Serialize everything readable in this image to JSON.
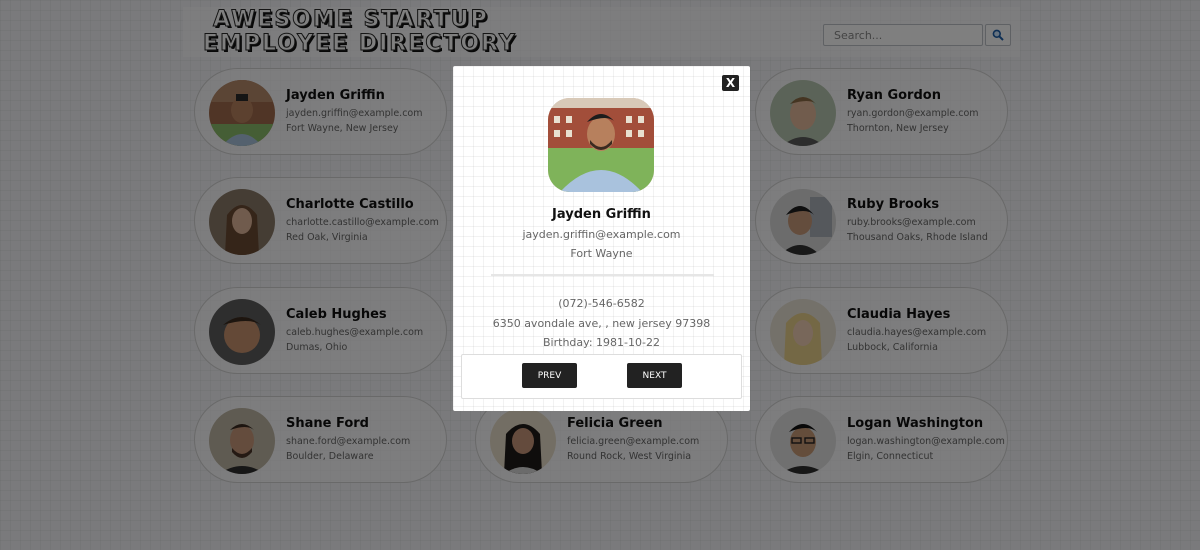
{
  "header": {
    "title_line1": "AWESOME STARTUP",
    "title_line2": "EMPLOYEE DIRECTORY",
    "search_placeholder": "Search...",
    "search_icon": "search-icon"
  },
  "employees": [
    {
      "name": "Jayden Griffin",
      "email": "jayden.griffin@example.com",
      "location": "Fort Wayne, New Jersey"
    },
    {
      "name": "Ryan Gordon",
      "email": "ryan.gordon@example.com",
      "location": "Thornton, New Jersey"
    },
    {
      "name": "Charlotte Castillo",
      "email": "charlotte.castillo@example.com",
      "location": "Red Oak, Virginia"
    },
    {
      "name": "Ruby Brooks",
      "email": "ruby.brooks@example.com",
      "location": "Thousand Oaks, Rhode Island"
    },
    {
      "name": "Caleb Hughes",
      "email": "caleb.hughes@example.com",
      "location": "Dumas, Ohio"
    },
    {
      "name": "Claudia Hayes",
      "email": "claudia.hayes@example.com",
      "location": "Lubbock, California"
    },
    {
      "name": "Shane Ford",
      "email": "shane.ford@example.com",
      "location": "Boulder, Delaware"
    },
    {
      "name": "Felicia Green",
      "email": "felicia.green@example.com",
      "location": "Round Rock, West Virginia"
    },
    {
      "name": "Logan Washington",
      "email": "logan.washington@example.com",
      "location": "Elgin, Connecticut"
    }
  ],
  "modal": {
    "close_label": "X",
    "name": "Jayden Griffin",
    "email": "jayden.griffin@example.com",
    "city": "Fort Wayne",
    "phone": "(072)-546-6582",
    "address": "6350 avondale ave, , new jersey 97398",
    "birthday": "Birthday: 1981-10-22",
    "prev_label": "PREV",
    "next_label": "NEXT"
  },
  "colors": {
    "overlay": "#000000",
    "button": "#222222",
    "page": "#f4f5f8"
  }
}
